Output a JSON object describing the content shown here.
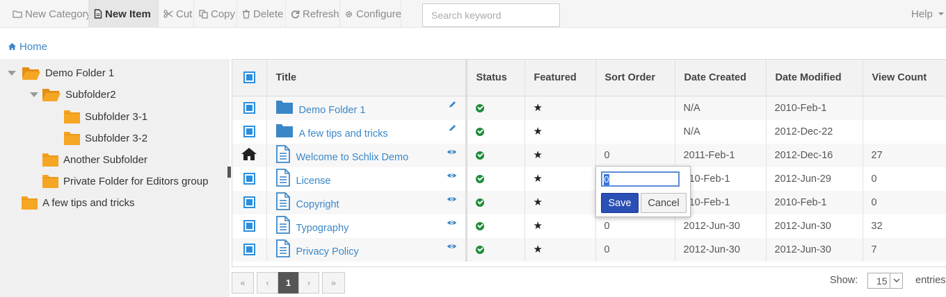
{
  "toolbar": {
    "new_category": "New Category",
    "new_item": "New Item",
    "cut": "Cut",
    "copy": "Copy",
    "delete": "Delete",
    "refresh": "Refresh",
    "configure": "Configure",
    "search_placeholder": "Search keyword",
    "help": "Help"
  },
  "breadcrumb": {
    "home": "Home"
  },
  "tree": {
    "nodes": [
      {
        "label": "Demo Folder 1",
        "open": true
      },
      {
        "label": "Subfolder2",
        "open": true
      },
      {
        "label": "Subfolder 3-1",
        "open": false
      },
      {
        "label": "Subfolder 3-2",
        "open": false
      },
      {
        "label": "Another Subfolder",
        "open": false
      },
      {
        "label": "Private Folder for Editors group",
        "open": false
      },
      {
        "label": "A few tips and tricks",
        "open": false
      }
    ]
  },
  "grid": {
    "columns": [
      "Title",
      "Status",
      "Featured",
      "Sort Order",
      "Date Created",
      "Date Modified",
      "View Count"
    ],
    "rows": [
      {
        "icon": "folder-icon",
        "title": "Demo Folder 1",
        "action": "pencil-icon",
        "sort_order": "",
        "date_created": "N/A",
        "date_modified": "2010-Feb-1",
        "view_count": "",
        "home": false
      },
      {
        "icon": "folder-icon",
        "title": "A few tips and tricks",
        "action": "pencil-icon",
        "sort_order": "",
        "date_created": "N/A",
        "date_modified": "2012-Dec-22",
        "view_count": "",
        "home": false
      },
      {
        "icon": "document-icon",
        "title": "Welcome to Schlix Demo",
        "action": "eye-icon",
        "sort_order": "0",
        "date_created": "2011-Feb-1",
        "date_modified": "2012-Dec-16",
        "view_count": "27",
        "home": true
      },
      {
        "icon": "document-icon",
        "title": "License",
        "action": "eye-icon",
        "sort_order": "",
        "date_created": "010-Feb-1",
        "date_modified": "2012-Jun-29",
        "view_count": "0",
        "home": false
      },
      {
        "icon": "document-icon",
        "title": "Copyright",
        "action": "eye-icon",
        "sort_order": "",
        "date_created": "010-Feb-1",
        "date_modified": "2010-Feb-1",
        "view_count": "0",
        "home": false
      },
      {
        "icon": "document-icon",
        "title": "Typography",
        "action": "eye-icon",
        "sort_order": "0",
        "date_created": "2012-Jun-30",
        "date_modified": "2012-Jun-30",
        "view_count": "32",
        "home": false
      },
      {
        "icon": "document-icon",
        "title": "Privacy Policy",
        "action": "eye-icon",
        "sort_order": "0",
        "date_created": "2012-Jun-30",
        "date_modified": "2012-Jun-30",
        "view_count": "7",
        "home": false
      }
    ]
  },
  "editor": {
    "value": "0",
    "save": "Save",
    "cancel": "Cancel"
  },
  "pager": {
    "first": "«",
    "prev": "‹",
    "current": "1",
    "next": "›",
    "last": "»"
  },
  "page_size": {
    "label": "Show:",
    "value": "15",
    "suffix": "entries"
  },
  "colors": {
    "link": "#3a87c8",
    "folder_tree": "#f5a623",
    "folder_grid": "#3a87c8",
    "status": "#1e8c3a",
    "save": "#2a4fb5"
  }
}
